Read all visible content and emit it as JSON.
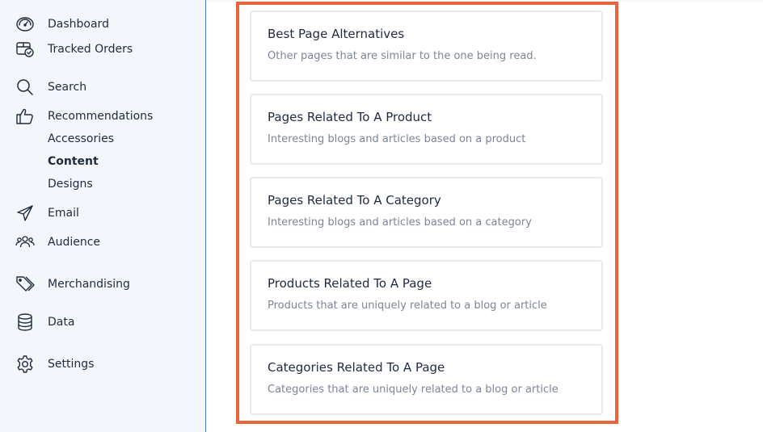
{
  "sidebar": {
    "items": [
      {
        "label": "Dashboard",
        "icon": "dashboard-gauge-icon"
      },
      {
        "label": "Tracked Orders",
        "icon": "tracked-orders-icon"
      },
      {
        "label": "Search",
        "icon": "search-icon"
      },
      {
        "label": "Recommendations",
        "icon": "thumbs-up-icon"
      },
      {
        "label": "Email",
        "icon": "paper-plane-icon"
      },
      {
        "label": "Audience",
        "icon": "users-icon"
      },
      {
        "label": "Merchandising",
        "icon": "tags-icon"
      },
      {
        "label": "Data",
        "icon": "database-icon"
      },
      {
        "label": "Settings",
        "icon": "gear-icon"
      }
    ],
    "sub_items": [
      {
        "label": "Accessories",
        "active": false
      },
      {
        "label": "Content",
        "active": true
      },
      {
        "label": "Designs",
        "active": false
      }
    ]
  },
  "cards": [
    {
      "title": "Best Page Alternatives",
      "description": "Other pages that are similar to the one being read."
    },
    {
      "title": "Pages Related To A Product",
      "description": "Interesting blogs and articles based on a product"
    },
    {
      "title": "Pages Related To A Category",
      "description": "Interesting blogs and articles based on a category"
    },
    {
      "title": "Products Related To A Page",
      "description": "Products that are uniquely related to a blog or article"
    },
    {
      "title": "Categories Related To A Page",
      "description": "Categories that are uniquely related to a blog or article"
    }
  ],
  "colors": {
    "highlight": "#e8643c",
    "sidebar_bg": "#f3f6fa",
    "divider": "#4a7bd0"
  }
}
